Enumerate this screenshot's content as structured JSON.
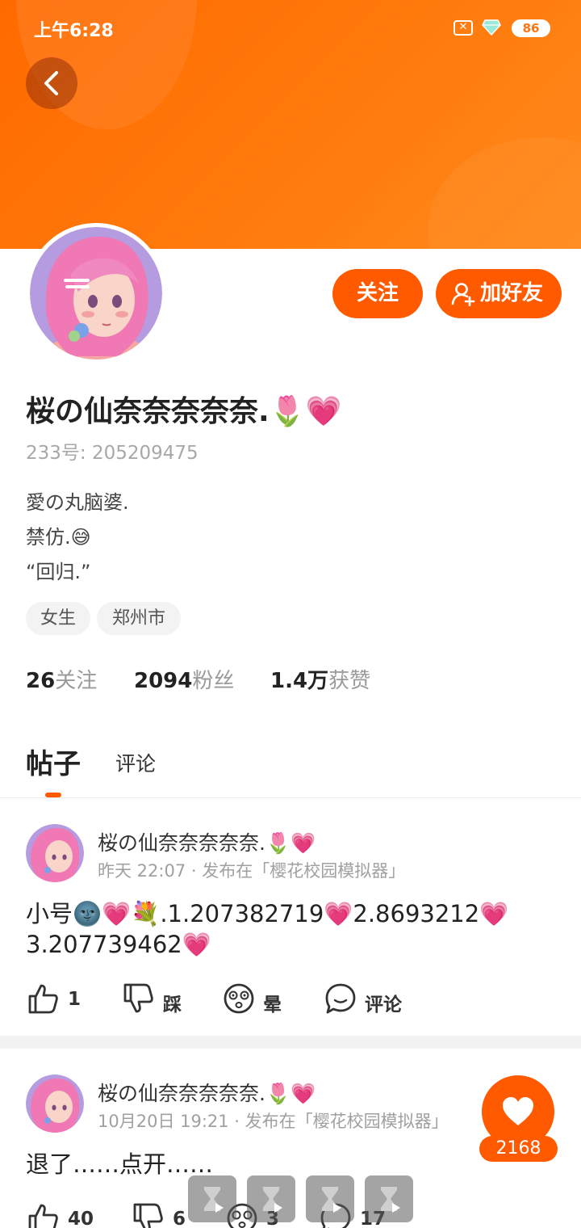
{
  "status_bar": {
    "time": "上午6:28",
    "battery": "86",
    "sim_icon": "sim-x-icon",
    "vip_icon": "diamond-icon"
  },
  "header": {
    "back_icon": "chevron-left-icon"
  },
  "profile": {
    "follow_label": "关注",
    "add_friend_label": "加好友",
    "username": "桜の仙奈奈奈奈奈.🌷💗",
    "uid": "233号: 205209475",
    "bio_lines": [
      "愛の丸脑婆.",
      "禁仿.😅",
      "“回归.”"
    ],
    "tags": [
      "女生",
      "郑州市"
    ],
    "stats": [
      {
        "value": "26",
        "label": "关注"
      },
      {
        "value": "2094",
        "label": "粉丝"
      },
      {
        "value": "1.4万",
        "label": "获赞"
      }
    ]
  },
  "tabs": {
    "posts": "帖子",
    "comments": "评论"
  },
  "posts": [
    {
      "author": "桜の仙奈奈奈奈奈.🌷💗",
      "meta": "昨天 22:07 · 发布在「樱花校园模拟器」",
      "text_lines": [
        "小号🌚💗💐.1.207382719💗2.8693212💗",
        "3.207739462💗"
      ],
      "actions": {
        "like": "1",
        "dislike": "踩",
        "dizzy": "晕",
        "comment": "评论"
      }
    },
    {
      "author": "桜の仙奈奈奈奈奈.🌷💗",
      "meta": "10月20日 19:21 · 发布在「樱花校园模拟器」",
      "text_lines": [
        "退了……点开……"
      ],
      "actions": {
        "like": "40",
        "dislike": "6",
        "dizzy": "3",
        "comment": "17"
      }
    }
  ],
  "fab": {
    "like_count": "2168"
  },
  "colors": {
    "brand": "#ff5a00",
    "banner": "#ff7411",
    "muted": "#a0a0a0"
  }
}
